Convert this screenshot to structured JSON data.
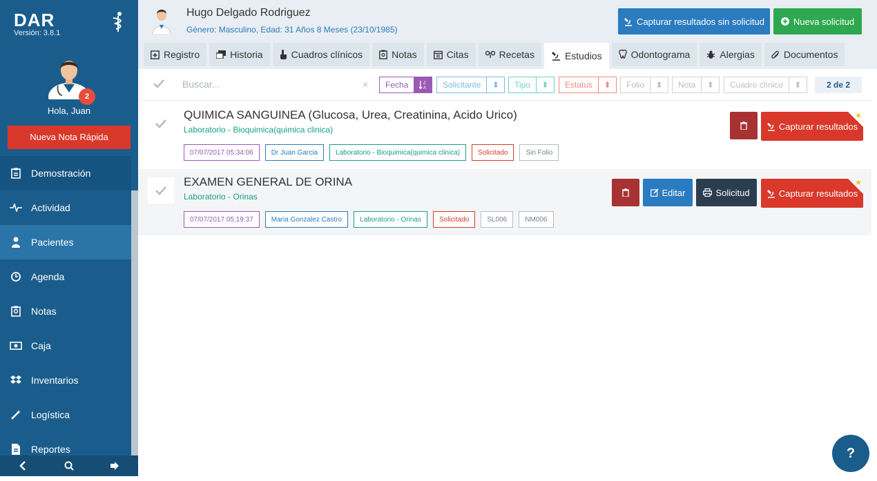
{
  "sidebar": {
    "brand": "DAR",
    "version": "Versión: 3.8.1",
    "notifications": "2",
    "greeting": "Hola, Juan",
    "quick_note": "Nueva Nota Rápida",
    "items": [
      {
        "label": "Demostración",
        "icon": "clipboard-icon"
      },
      {
        "label": "Actividad",
        "icon": "heartbeat-icon"
      },
      {
        "label": "Pacientes",
        "icon": "patient-icon"
      },
      {
        "label": "Agenda",
        "icon": "clock-icon"
      },
      {
        "label": "Notas",
        "icon": "notes-icon"
      },
      {
        "label": "Caja",
        "icon": "cash-icon"
      },
      {
        "label": "Inventarios",
        "icon": "dropbox-icon"
      },
      {
        "label": "Logística",
        "icon": "magic-wand-icon"
      },
      {
        "label": "Reportes",
        "icon": "file-icon"
      }
    ]
  },
  "header": {
    "patient_name": "Hugo Delgado Rodriguez",
    "patient_info": "Género: Masculino, Edad: 31 Años 8 Meses (23/10/1985)",
    "btn_capture": "Capturar resultados sin solicitud",
    "btn_new": "Nueva solicitud"
  },
  "tabs": [
    {
      "label": "Registro"
    },
    {
      "label": "Historia"
    },
    {
      "label": "Cuadros clínicos"
    },
    {
      "label": "Notas"
    },
    {
      "label": "Citas"
    },
    {
      "label": "Recetas"
    },
    {
      "label": "Estudios"
    },
    {
      "label": "Odontograma"
    },
    {
      "label": "Alergias"
    },
    {
      "label": "Documentos"
    }
  ],
  "filters": {
    "search_placeholder": "Buscar...",
    "clear": "×",
    "fecha": "Fecha",
    "solicitante": "Solicitante",
    "tipo": "Tipo",
    "estatus": "Estatus",
    "folio": "Folio",
    "nota": "Nota",
    "cuadro": "Cuadro clínico",
    "count": "2 de 2"
  },
  "studies": [
    {
      "title": "QUIMICA SANGUINEA (Glucosa, Urea, Creatinina, Acido Urico)",
      "subtitle": "Laboratorio - Bioquimica(quimica clinica)",
      "tags": {
        "date": "07/07/2017 05:34:06",
        "doctor": "Dr Juan Garcia",
        "lab": "Laboratorio - Bioquimica(quimica clinica)",
        "status": "Solicitado",
        "folio": "Sin Folio"
      },
      "capture_label": "Capturar resultados"
    },
    {
      "title": "EXAMEN GENERAL DE ORINA",
      "subtitle": "Laboratorio - Orinas",
      "tags": {
        "date": "07/07/2017 05:19:37",
        "doctor": "Maria Gonzalez Castro",
        "lab": "Laboratorio - Orinas",
        "status": "Solicitado",
        "folio": "SL006",
        "nota": "NM006"
      },
      "edit_label": "Editar",
      "request_label": "Solicitud",
      "capture_label": "Capturar resultados"
    }
  ],
  "help": "?",
  "colors": {
    "sidebar": "#1a5d8c",
    "danger": "#d9382a",
    "primary": "#2a7bc0",
    "success": "#2ea84f"
  }
}
